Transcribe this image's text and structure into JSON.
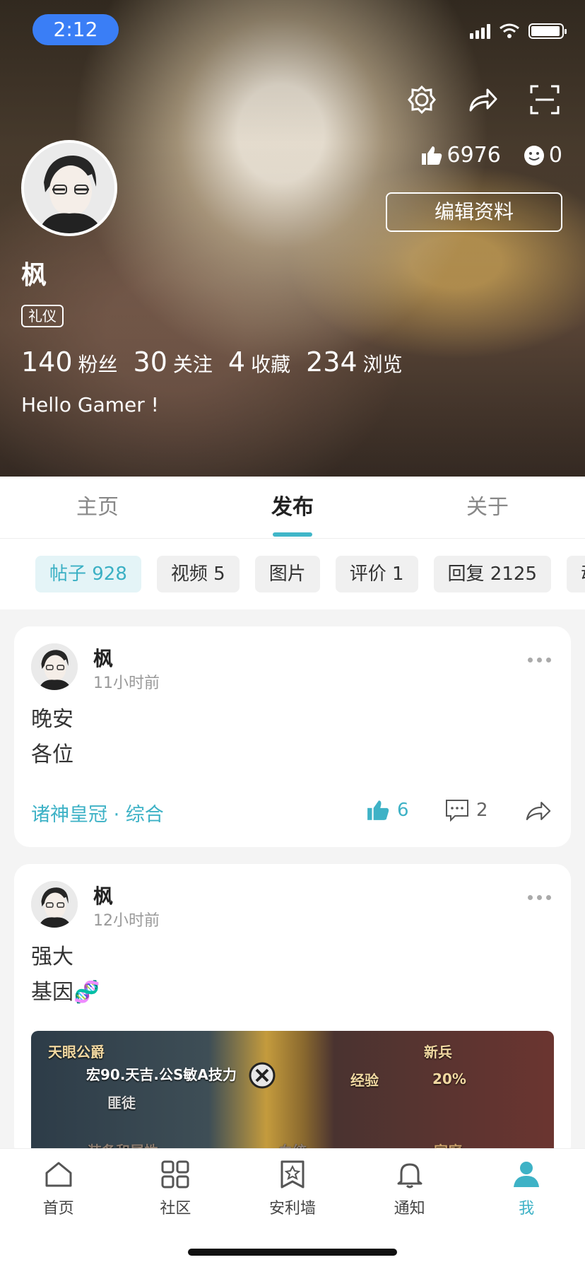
{
  "status": {
    "time": "2:12"
  },
  "profile": {
    "likes": "6976",
    "smile_count": "0",
    "edit_button": "编辑资料",
    "name": "枫",
    "tag": "礼仪",
    "counts": [
      {
        "value": "140",
        "label": "粉丝"
      },
      {
        "value": "30",
        "label": "关注"
      },
      {
        "value": "4",
        "label": "收藏"
      },
      {
        "value": "234",
        "label": "浏览"
      }
    ],
    "bio": "Hello Gamer !"
  },
  "tabs": [
    "主页",
    "发布",
    "关于"
  ],
  "chips": [
    "帖子 928",
    "视频 5",
    "图片",
    "评价 1",
    "回复 2125",
    "动"
  ],
  "posts": [
    {
      "name": "枫",
      "time": "11小时前",
      "lines": [
        "晚安",
        "各位"
      ],
      "topic": "诸神皇冠 · 综合",
      "likes": "6",
      "comments": "2"
    },
    {
      "name": "枫",
      "time": "12小时前",
      "lines": [
        "强大",
        "基因🧬"
      ],
      "image_texts": [
        "天眼公爵",
        "宏90.天吉.公S敏A技力",
        "匪徒",
        "新兵",
        "经验",
        "20%",
        "装备和属性",
        "血统",
        "家庭"
      ]
    }
  ],
  "nav": [
    "首页",
    "社区",
    "安利墙",
    "通知",
    "我"
  ],
  "colors": {
    "accent": "#3eb2c6",
    "time_pill": "#3a7ef6"
  }
}
